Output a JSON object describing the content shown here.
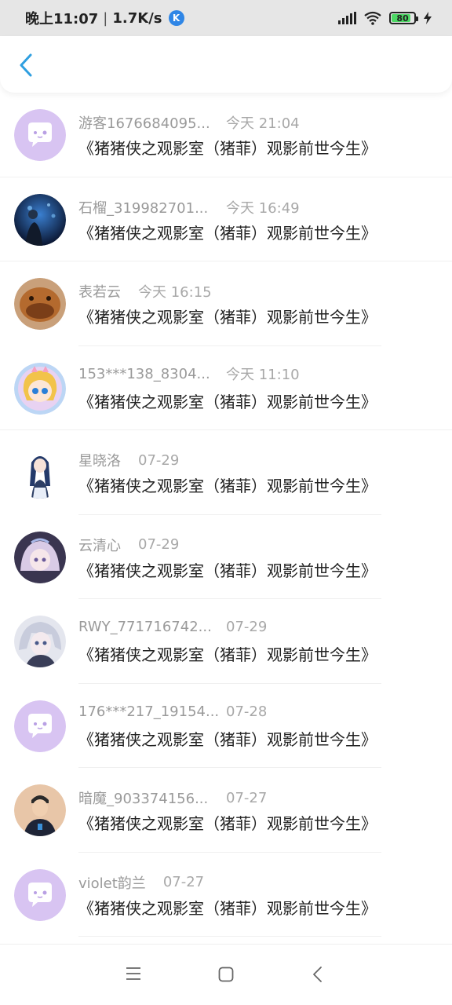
{
  "status_bar": {
    "time": "晚上11:07",
    "speed": "1.7K/s",
    "app_badge": "K",
    "battery": "80"
  },
  "nav": {
    "back_icon": "chevron-left-icon"
  },
  "items": [
    {
      "name": "游客1676684095...",
      "time": "今天 21:04",
      "title": "《猪猪侠之观影室（猪菲）观影前世今生》",
      "avatar": "default-chat-avatar"
    },
    {
      "name": "石榴_319982701...",
      "time": "今天 16:49",
      "title": "《猪猪侠之观影室（猪菲）观影前世今生》",
      "avatar": "photo-avatar-stage"
    },
    {
      "name": "表若云",
      "time": "今天 16:15",
      "title": "《猪猪侠之观影室（猪菲）观影前世今生》",
      "avatar": "photo-avatar-platypus"
    },
    {
      "name": "153***138_8304...",
      "time": "今天 11:10",
      "title": "《猪猪侠之观影室（猪菲）观影前世今生》",
      "avatar": "photo-avatar-anime-girl-blonde"
    },
    {
      "name": "星晓洛",
      "time": "07-29",
      "title": "《猪猪侠之观影室（猪菲）观影前世今生》",
      "avatar": "photo-avatar-anime-girl-dark-hair"
    },
    {
      "name": "云清心",
      "time": "07-29",
      "title": "《猪猪侠之观影室（猪菲）观影前世今生》",
      "avatar": "photo-avatar-anime-princess"
    },
    {
      "name": "RWY_771716742...",
      "time": "07-29",
      "title": "《猪猪侠之观影室（猪菲）观影前世今生》",
      "avatar": "photo-avatar-anime-silver-hair"
    },
    {
      "name": "176***217_19154...",
      "time": "07-28",
      "title": "《猪猪侠之观影室（猪菲）观影前世今生》",
      "avatar": "default-chat-avatar"
    },
    {
      "name": "暗魔_903374156...",
      "time": "07-27",
      "title": "《猪猪侠之观影室（猪菲）观影前世今生》",
      "avatar": "photo-avatar-boy"
    },
    {
      "name": "violet韵兰",
      "time": "07-27",
      "title": "《猪猪侠之观影室（猪菲）观影前世今生》",
      "avatar": "default-chat-avatar"
    }
  ],
  "bottom_nav": {
    "menu_icon": "menu-icon",
    "home_icon": "home-square-icon",
    "back_icon": "back-chevron-icon"
  },
  "colors": {
    "accent": "#2f9fe0",
    "default_avatar_bg": "#d8c4f2"
  }
}
